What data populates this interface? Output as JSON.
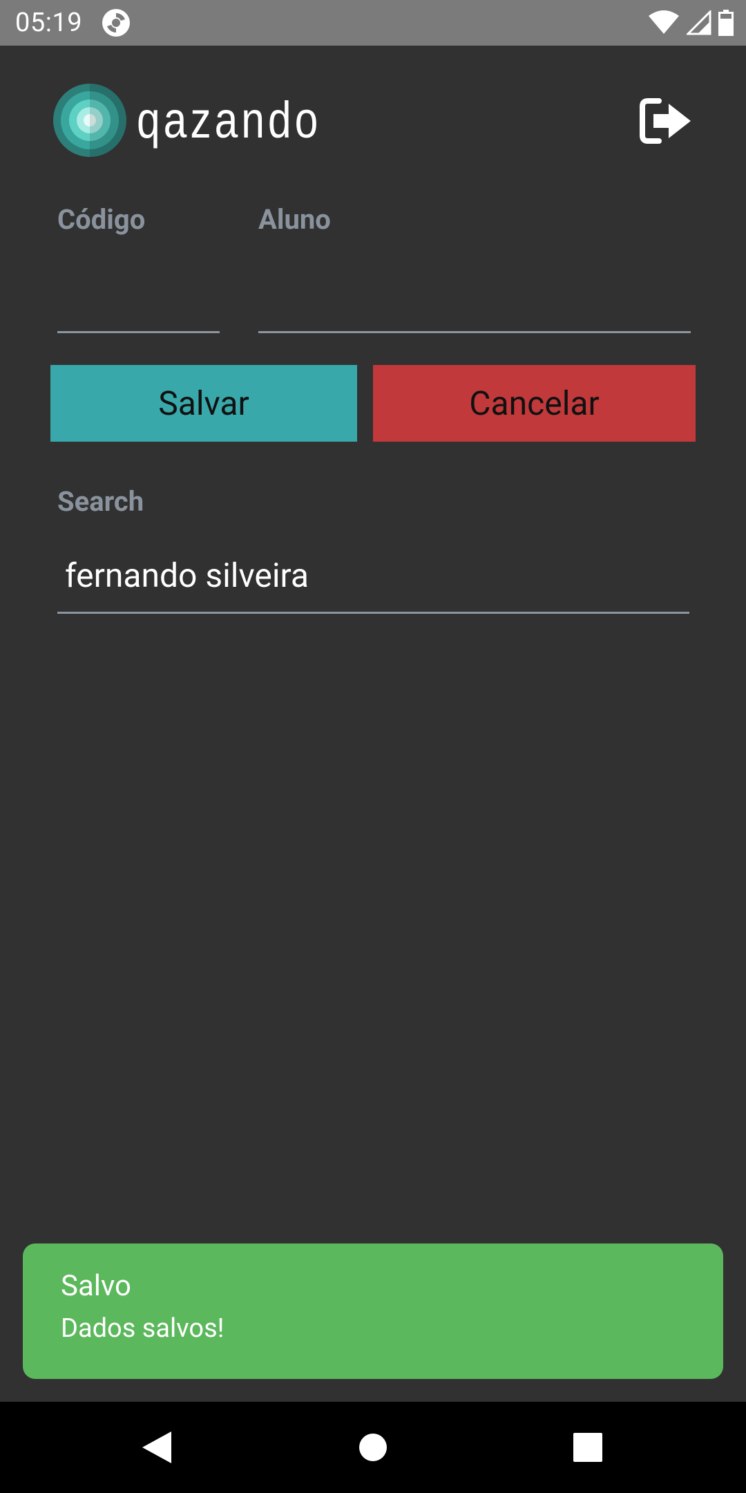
{
  "status_bar": {
    "time": "05:19",
    "icons": [
      "sync-app-icon",
      "wifi-icon",
      "cell-signal-icon",
      "battery-icon"
    ]
  },
  "header": {
    "logo_text": "qazando",
    "logout_icon": "logout-icon"
  },
  "form": {
    "code_label": "Código",
    "code_value": "",
    "student_label": "Aluno",
    "student_value": "",
    "save_label": "Salvar",
    "cancel_label": "Cancelar",
    "search_label": "Search",
    "search_value": "fernando silveira"
  },
  "toast": {
    "title": "Salvo",
    "message": "Dados salvos!"
  },
  "colors": {
    "background": "#313131",
    "save": "#38a8ab",
    "cancel": "#c1393b",
    "toast": "#5cb85c",
    "label": "#8a939d"
  },
  "nav_bar": {
    "icons": [
      "back-icon",
      "home-icon",
      "recents-icon"
    ]
  }
}
